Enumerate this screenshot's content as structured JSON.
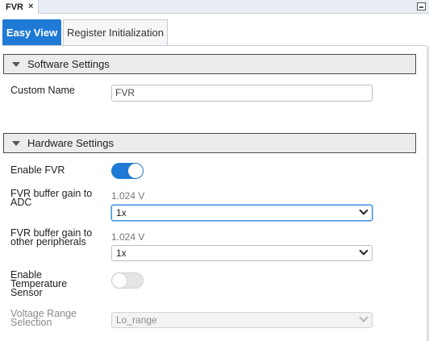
{
  "window": {
    "tab_label": "FVR",
    "close_glyph": "×"
  },
  "view_tabs": {
    "easy_view": "Easy View",
    "register_init": "Register Initialization",
    "active": "easy_view"
  },
  "software_settings": {
    "title": "Software Settings",
    "custom_name": {
      "label": "Custom Name",
      "value": "FVR"
    }
  },
  "hardware_settings": {
    "title": "Hardware Settings",
    "enable_fvr": {
      "label": "Enable FVR",
      "enabled": true
    },
    "gain_adc": {
      "label": "FVR buffer gain to ADC",
      "hint": "1.024 V",
      "value": "1x"
    },
    "gain_periph": {
      "label": "FVR buffer gain to other peripherals",
      "hint": "1.024 V",
      "value": "1x"
    },
    "enable_temp": {
      "label": "Enable Temperature Sensor",
      "enabled": false
    },
    "voltage_range": {
      "label": "Voltage Range Selection",
      "value": "Lo_range",
      "disabled": true
    }
  },
  "icons": {
    "close": "close-icon",
    "minimize": "minimize-icon",
    "collapse": "triangle-down-icon",
    "dropdown": "chevron-down-icon"
  },
  "colors": {
    "accent": "#1f7ad6",
    "section_bg": "#ececec",
    "toggle_off": "#e4e4e4"
  }
}
